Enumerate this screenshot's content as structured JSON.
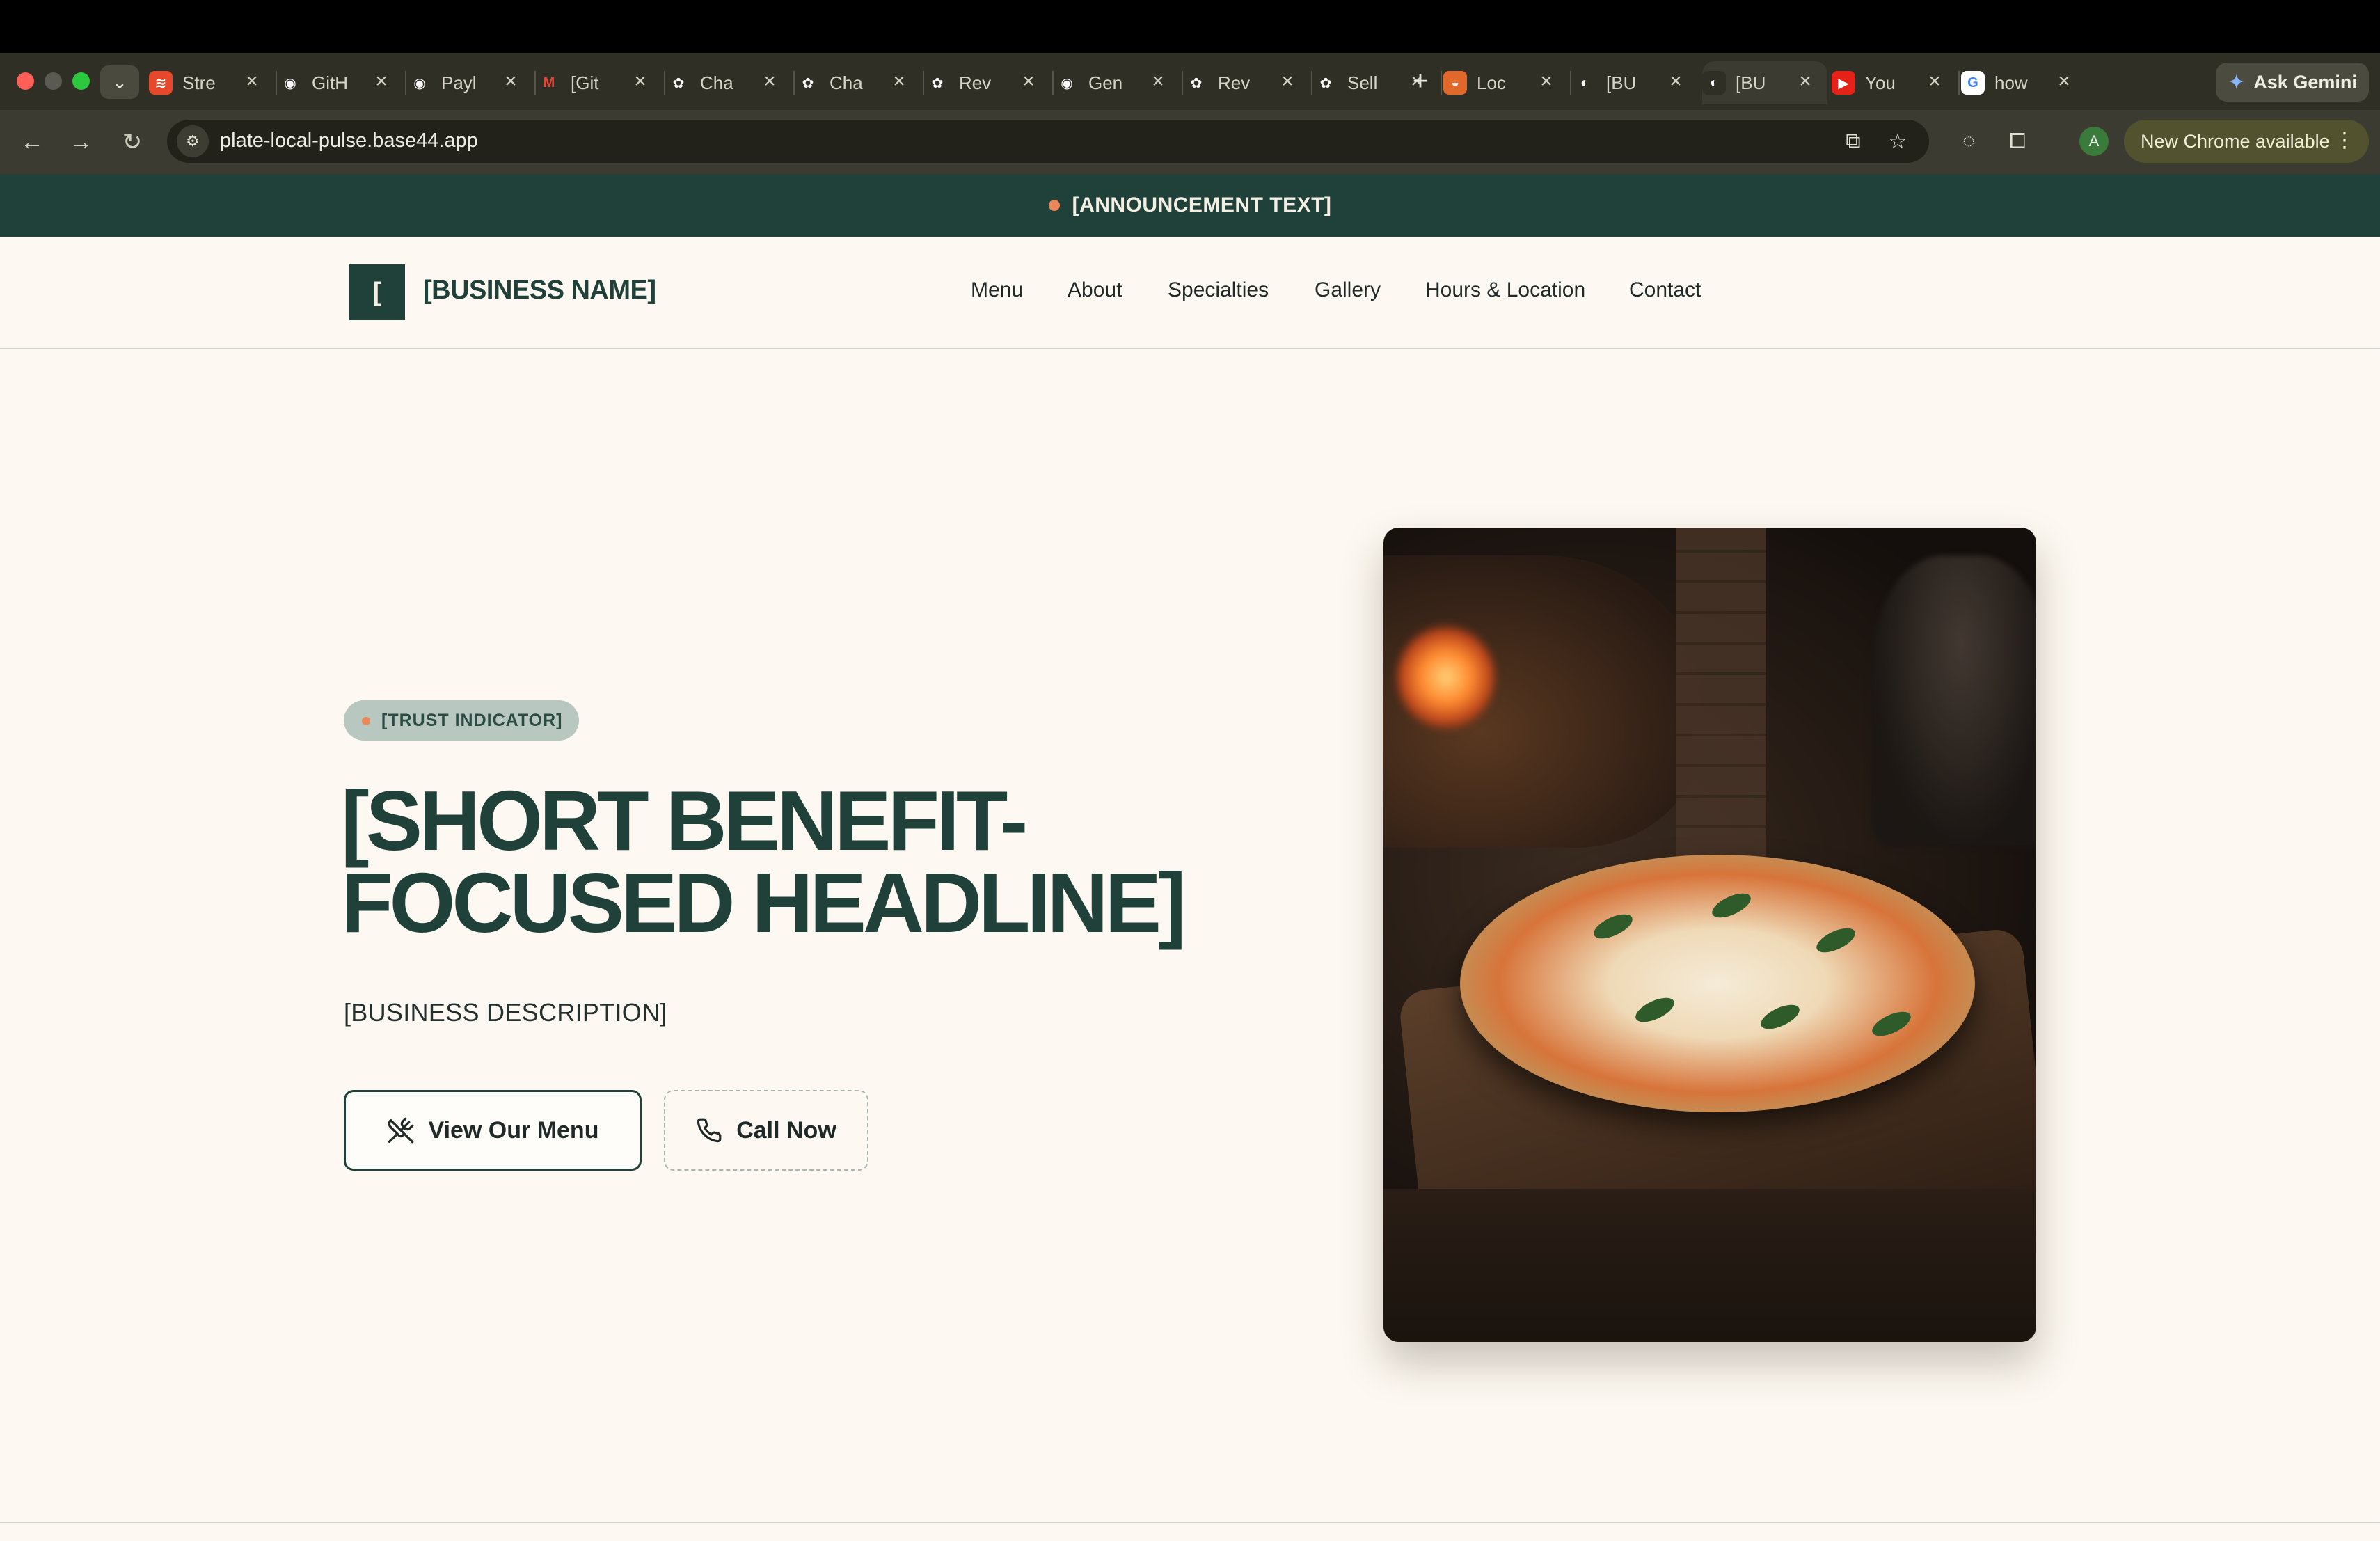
{
  "browser": {
    "tabs": [
      {
        "label": "Stre",
        "icon": "soundcloud-icon",
        "color": "#e5482b",
        "glyph": "≋"
      },
      {
        "label": "GitH",
        "icon": "github-icon",
        "color": "#2f2f26",
        "glyph": "◉"
      },
      {
        "label": "Payl",
        "icon": "github-icon",
        "color": "#2f2f26",
        "glyph": "◉"
      },
      {
        "label": "[Git",
        "icon": "gmail-icon",
        "color": "#2f2f26",
        "glyph": "M"
      },
      {
        "label": "Cha",
        "icon": "openai-icon",
        "color": "#2f2f26",
        "glyph": "✿"
      },
      {
        "label": "Cha",
        "icon": "openai-icon",
        "color": "#2f2f26",
        "glyph": "✿"
      },
      {
        "label": "Rev",
        "icon": "openai-icon",
        "color": "#2f2f26",
        "glyph": "✿"
      },
      {
        "label": "Gen",
        "icon": "github-icon",
        "color": "#2f2f26",
        "glyph": "◉"
      },
      {
        "label": "Rev",
        "icon": "openai-icon",
        "color": "#2f2f26",
        "glyph": "✿"
      },
      {
        "label": "Sell",
        "icon": "openai-icon",
        "color": "#2f2f26",
        "glyph": "✿"
      },
      {
        "label": "Loc",
        "icon": "sunset-icon",
        "color": "#e0682a",
        "glyph": "◒"
      },
      {
        "label": "[BU",
        "icon": "base44-icon",
        "color": "#2f2f26",
        "glyph": "◐"
      },
      {
        "label": "[BU",
        "icon": "base44-icon",
        "color": "#2f2f26",
        "glyph": "◐"
      },
      {
        "label": "You",
        "icon": "youtube-icon",
        "color": "#e62117",
        "glyph": "▶"
      },
      {
        "label": "how",
        "icon": "google-icon",
        "color": "#ffffff",
        "glyph": "G"
      }
    ],
    "active_tab_index": 12,
    "ask_gemini": "Ask Gemini",
    "url": "plate-local-pulse.base44.app",
    "update_label": "New Chrome available",
    "avatar_letter": "A"
  },
  "site": {
    "announcement": "[ANNOUNCEMENT TEXT]",
    "logo_letter": "[",
    "business_name": "[BUSINESS NAME]",
    "nav": [
      "Menu",
      "About",
      "Specialties",
      "Gallery",
      "Hours & Location",
      "Contact"
    ],
    "trust_indicator": "[TRUST INDICATOR]",
    "headline": "[SHORT BENEFIT-FOCUSED HEADLINE]",
    "description": "[BUSINESS DESCRIPTION]",
    "cta_primary": "View Our Menu",
    "cta_secondary": "Call Now",
    "hero_image": "wood-fired-pizza-photo",
    "colors": {
      "brand": "#1f4139",
      "accent": "#e8885a",
      "background": "#fdf8f1"
    }
  }
}
